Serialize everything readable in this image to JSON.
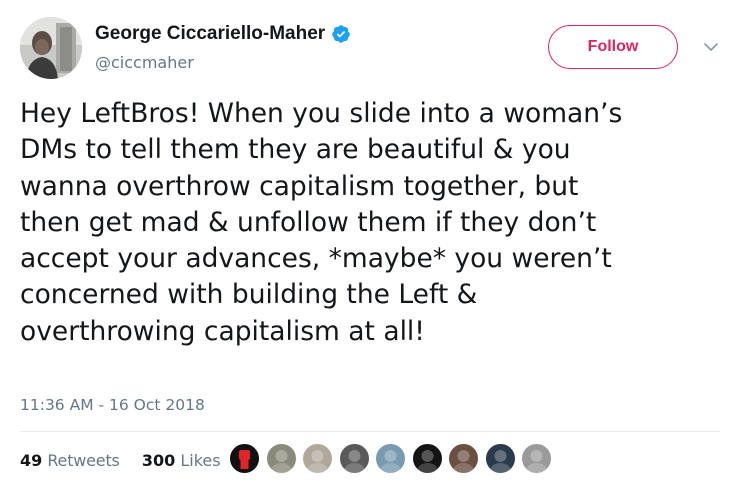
{
  "tweet": {
    "author": {
      "display_name": "George Ciccariello-Maher",
      "handle": "@ciccmaher",
      "verified": true
    },
    "follow_label": "Follow",
    "text_lines": [
      "Hey LeftBros! When you slide into a woman’s",
      "DMs to tell them they are beautiful & you",
      "wanna overthrow capitalism together, but",
      "then get mad & unfollow them if they don’t",
      "accept your advances, *maybe* you weren’t",
      "concerned with building the Left &",
      "overthrowing capitalism at all!"
    ],
    "timestamp": "11:36 AM - 16 Oct 2018",
    "stats": {
      "retweets_count": "49",
      "retweets_label": "Retweets",
      "likes_count": "300",
      "likes_label": "Likes"
    },
    "liker_avatars": [
      {
        "icon": "raised-fist-avatar",
        "color": "#111111"
      },
      {
        "icon": "person-avatar",
        "color": "#8a8a7a"
      },
      {
        "icon": "person-avatar",
        "color": "#b0a89a"
      },
      {
        "icon": "person-avatar",
        "color": "#5a5a5a"
      },
      {
        "icon": "person-avatar",
        "color": "#7a9ab0"
      },
      {
        "icon": "person-avatar",
        "color": "#141414"
      },
      {
        "icon": "person-avatar",
        "color": "#6a5040"
      },
      {
        "icon": "person-avatar",
        "color": "#2a3a4a"
      },
      {
        "icon": "person-avatar",
        "color": "#9a9a9a"
      }
    ],
    "colors": {
      "accent": "#e0245e",
      "verified": "#1da1f2",
      "secondary_text": "#657786",
      "divider": "#e6ecf0"
    }
  }
}
